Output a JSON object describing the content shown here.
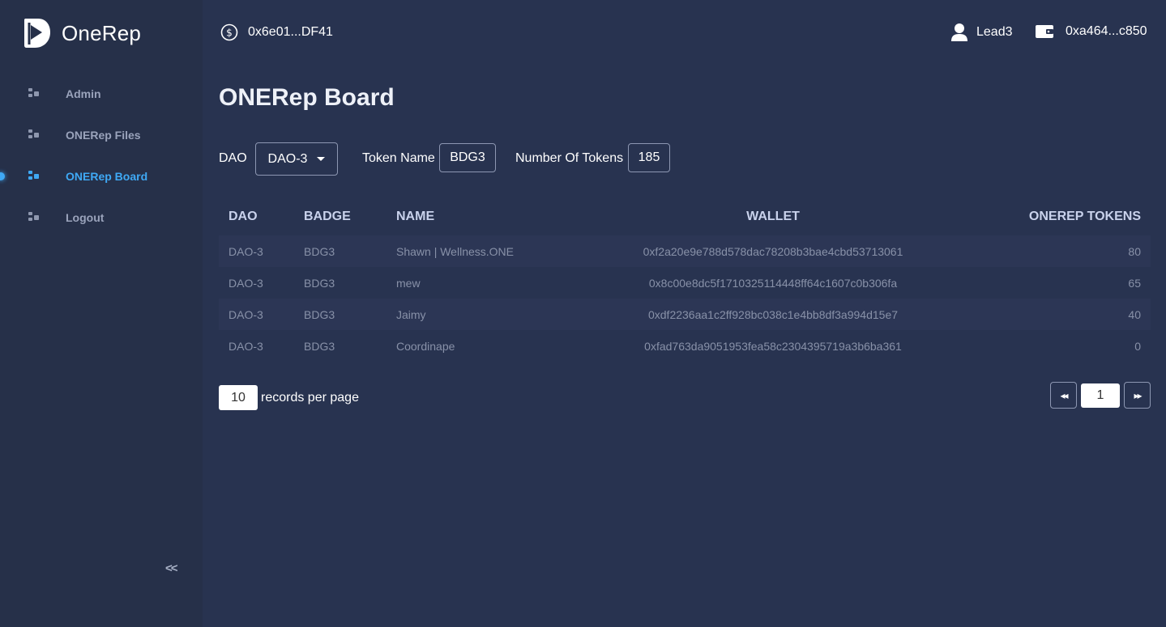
{
  "app": {
    "name": "OneRep"
  },
  "sidebar": {
    "items": [
      {
        "label": "Admin",
        "active": false
      },
      {
        "label": "ONERep Files",
        "active": false
      },
      {
        "label": "ONERep Board",
        "active": true
      },
      {
        "label": "Logout",
        "active": false
      }
    ],
    "collapse_label": "<<"
  },
  "header": {
    "contract_address": "0x6e01...DF41",
    "user_name": "Lead3",
    "wallet_address": "0xa464...c850"
  },
  "page": {
    "title": "ONERep Board"
  },
  "filters": {
    "dao_label": "DAO",
    "dao_value": "DAO-3",
    "token_name_label": "Token Name",
    "token_name_value": "BDG3",
    "num_tokens_label": "Number Of Tokens",
    "num_tokens_value": "185"
  },
  "table": {
    "columns": [
      "DAO",
      "BADGE",
      "NAME",
      "WALLET",
      "ONEREP TOKENS"
    ],
    "rows": [
      {
        "dao": "DAO-3",
        "badge": "BDG3",
        "name": "Shawn | Wellness.ONE",
        "wallet": "0xf2a20e9e788d578dac78208b3bae4cbd53713061",
        "tokens": "80"
      },
      {
        "dao": "DAO-3",
        "badge": "BDG3",
        "name": "mew",
        "wallet": "0x8c00e8dc5f1710325114448ff64c1607c0b306fa",
        "tokens": "65"
      },
      {
        "dao": "DAO-3",
        "badge": "BDG3",
        "name": "Jaimy",
        "wallet": "0xdf2236aa1c2ff928bc038c1e4bb8df3a994d15e7",
        "tokens": "40"
      },
      {
        "dao": "DAO-3",
        "badge": "BDG3",
        "name": "Coordinape",
        "wallet": "0xfad763da9051953fea58c2304395719a3b6ba361",
        "tokens": "0"
      }
    ]
  },
  "pagination": {
    "per_page": "10",
    "per_page_label": "records per page",
    "first_label": "◂◂",
    "current_page": "1",
    "last_label": "▸▸"
  },
  "colors": {
    "accent": "#3fa9f5",
    "background": "#283350",
    "sidebar": "#263049"
  },
  "icons": {
    "logo": "onerep-logo-icon",
    "nav": "grid-dots-icon",
    "contract": "dollar-circle-icon",
    "user": "user-icon",
    "wallet": "wallet-icon"
  }
}
